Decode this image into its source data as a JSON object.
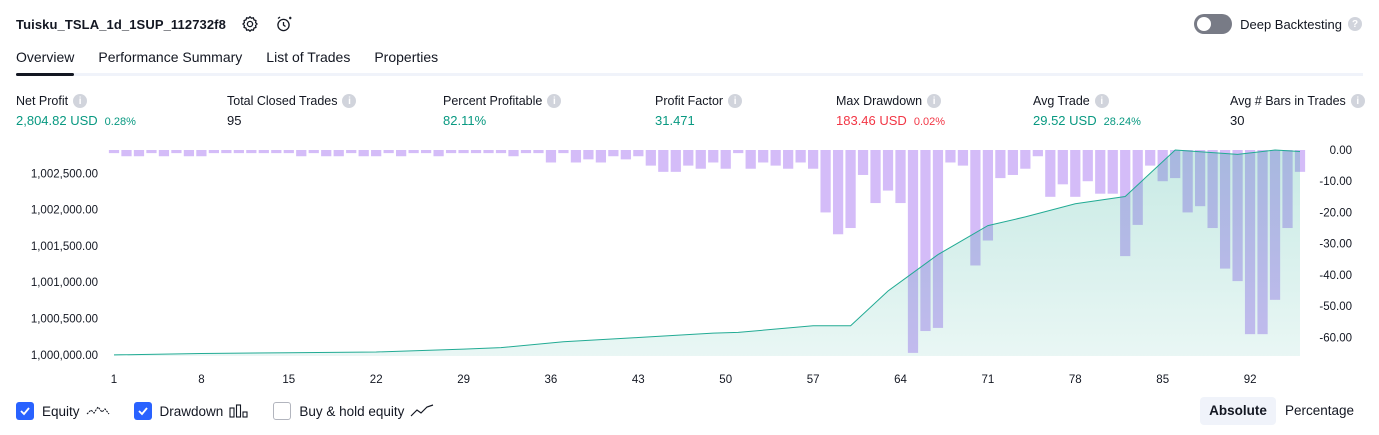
{
  "header": {
    "strategy_name": "Tuisku_TSLA_1d_1SUP_112732f8",
    "deep_backtesting_label": "Deep Backtesting",
    "deep_backtesting_on": false
  },
  "tabs": [
    {
      "label": "Overview",
      "active": true
    },
    {
      "label": "Performance Summary",
      "active": false
    },
    {
      "label": "List of Trades",
      "active": false
    },
    {
      "label": "Properties",
      "active": false
    }
  ],
  "stats": {
    "net_profit": {
      "label": "Net Profit",
      "value": "2,804.82 USD",
      "pct": "0.28%"
    },
    "total_closed_trades": {
      "label": "Total Closed Trades",
      "value": "95"
    },
    "percent_profitable": {
      "label": "Percent Profitable",
      "value": "82.11%"
    },
    "profit_factor": {
      "label": "Profit Factor",
      "value": "31.471"
    },
    "max_drawdown": {
      "label": "Max Drawdown",
      "value": "183.46 USD",
      "pct": "0.02%"
    },
    "avg_trade": {
      "label": "Avg Trade",
      "value": "29.52 USD",
      "pct": "28.24%"
    },
    "avg_bars": {
      "label": "Avg # Bars in Trades",
      "value": "30"
    }
  },
  "chart_data": {
    "type": "area",
    "equity_axis_ticks": [
      "1,002,500.00",
      "1,002,000.00",
      "1,001,500.00",
      "1,001,000.00",
      "1,000,500.00",
      "1,000,000.00"
    ],
    "equity_axis_values": [
      1002500,
      1002000,
      1001500,
      1001000,
      1000500,
      1000000
    ],
    "equity_ylim": [
      999985,
      1002820
    ],
    "drawdown_axis_ticks": [
      "0.00",
      "-10.00",
      "-20.00",
      "-30.00",
      "-40.00",
      "-50.00",
      "-60.00"
    ],
    "drawdown_axis_values": [
      0,
      -10,
      -20,
      -30,
      -40,
      -50,
      -60
    ],
    "drawdown_ylim": [
      -66,
      0
    ],
    "x_ticks": [
      "1",
      "8",
      "15",
      "22",
      "29",
      "36",
      "43",
      "50",
      "57",
      "64",
      "71",
      "78",
      "85",
      "92"
    ],
    "x_range": [
      1,
      96
    ],
    "series": [
      {
        "name": "Equity",
        "color": "#22ab94",
        "x": [
          1,
          8,
          15,
          22,
          29,
          32,
          37,
          43,
          49,
          51,
          57,
          60,
          63,
          67,
          71,
          74,
          78,
          82,
          86,
          91,
          94,
          96
        ],
        "y": [
          1000000,
          1000020,
          1000030,
          1000040,
          1000080,
          1000100,
          1000180,
          1000240,
          1000300,
          1000310,
          1000400,
          1000400,
          1000880,
          1001380,
          1001780,
          1001900,
          1002080,
          1002180,
          1002820,
          1002760,
          1002820,
          1002800
        ]
      },
      {
        "name": "Drawdown",
        "color": "#c6a5f5",
        "x": [
          1,
          2,
          3,
          4,
          5,
          6,
          7,
          8,
          9,
          10,
          11,
          12,
          13,
          14,
          15,
          16,
          17,
          18,
          19,
          20,
          21,
          22,
          23,
          24,
          25,
          26,
          27,
          28,
          29,
          30,
          31,
          32,
          33,
          34,
          35,
          36,
          37,
          38,
          39,
          40,
          41,
          42,
          43,
          44,
          45,
          46,
          47,
          48,
          49,
          50,
          51,
          52,
          53,
          54,
          55,
          56,
          57,
          58,
          59,
          60,
          61,
          62,
          63,
          64,
          65,
          66,
          67,
          68,
          69,
          70,
          71,
          72,
          73,
          74,
          75,
          76,
          77,
          78,
          79,
          80,
          81,
          82,
          83,
          84,
          85,
          86,
          87,
          88,
          89,
          90,
          91,
          92,
          93,
          94,
          95,
          96
        ],
        "values": [
          -1,
          -2,
          -2,
          -1,
          -2,
          -1,
          -2,
          -2,
          -1,
          -1,
          -1,
          -1,
          -1,
          -1,
          -1,
          -2,
          -1,
          -2,
          -2,
          -1,
          -2,
          -2,
          -1,
          -2,
          -1,
          -1,
          -2,
          -1,
          -1,
          -1,
          -1,
          -1,
          -2,
          -1,
          -1,
          -4,
          -1,
          -4,
          -3,
          -4,
          -2,
          -3,
          -2,
          -5,
          -7,
          -7,
          -5,
          -6,
          -4,
          -6,
          -1,
          -6,
          -4,
          -5,
          -6,
          -4,
          -6,
          -20,
          -27,
          -25,
          -8,
          -17,
          -13,
          -17,
          -65,
          -58,
          -57,
          -4,
          -5,
          -37,
          -29,
          -9,
          -8,
          -6,
          -2,
          -15,
          -11,
          -15,
          -10,
          -14,
          -14,
          -34,
          -24,
          -5,
          -10,
          -9,
          -20,
          -18,
          -25,
          -38,
          -42,
          -59,
          -59,
          -48,
          -25,
          -7
        ]
      }
    ],
    "grid": false
  },
  "legend": {
    "equity_label": "Equity",
    "drawdown_label": "Drawdown",
    "buyhold_label": "Buy & hold equity",
    "equity_checked": true,
    "drawdown_checked": true,
    "buyhold_checked": false
  },
  "mode_switch": {
    "absolute_label": "Absolute",
    "percentage_label": "Percentage"
  },
  "colors": {
    "accent": "#2962ff",
    "positive": "#089981",
    "negative": "#f23645",
    "equity_line": "#22ab94",
    "drawdown_bar": "#c6a5f5"
  }
}
